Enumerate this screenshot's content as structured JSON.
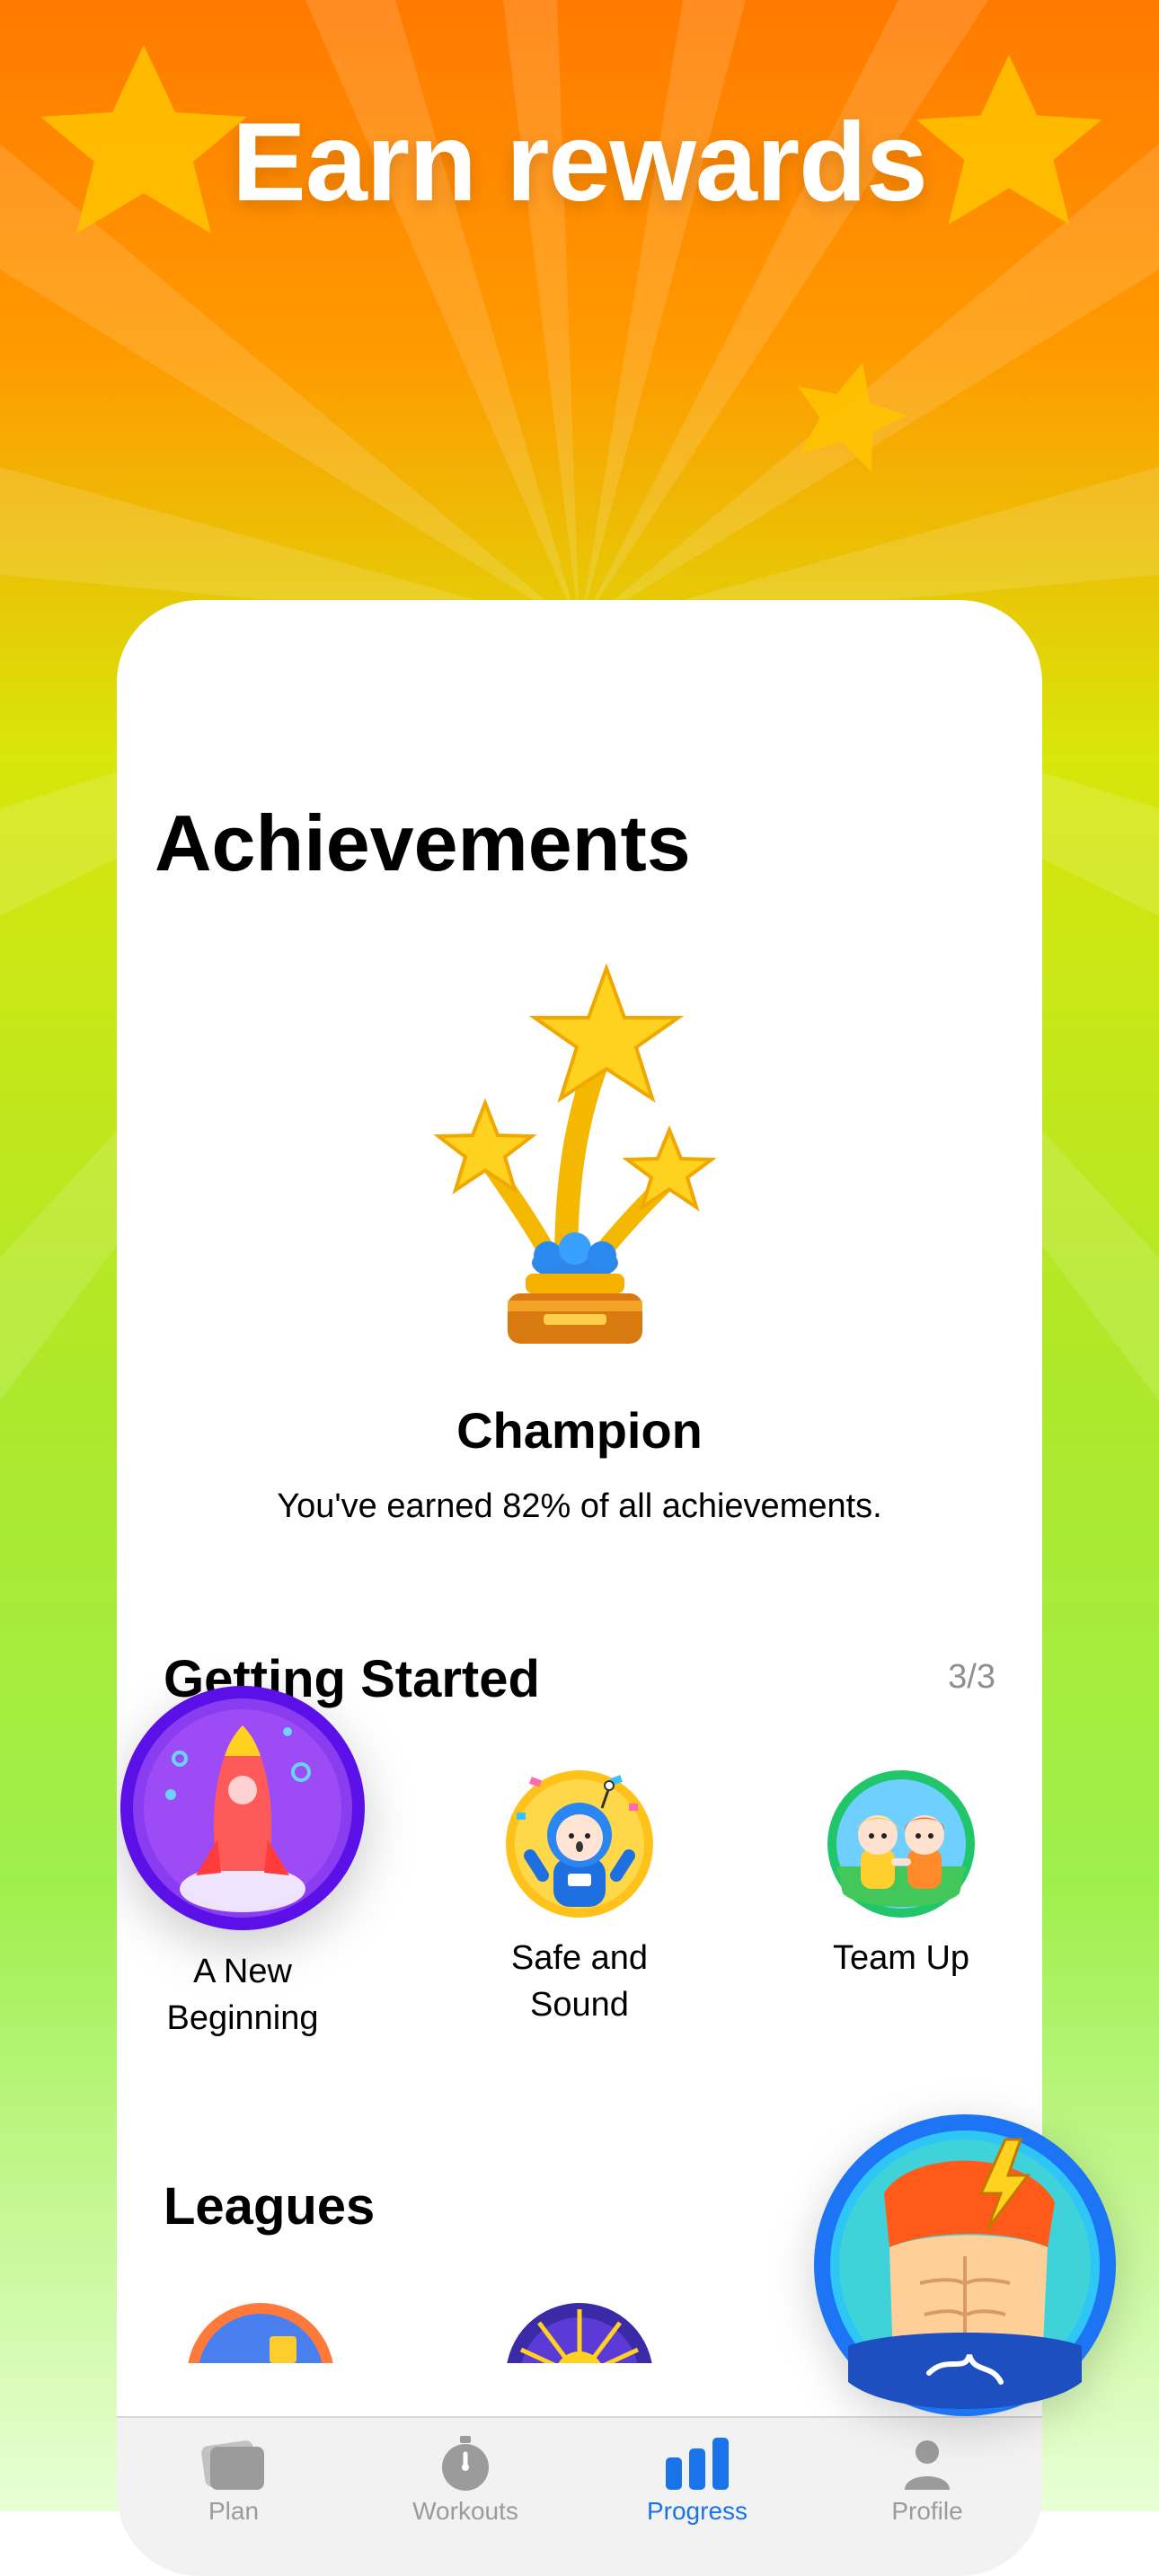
{
  "headline": "Earn rewards",
  "achievements": {
    "title": "Achievements",
    "trophy_name": "Champion",
    "earned_text": "You've earned 82% of all achievements."
  },
  "getting_started": {
    "title": "Getting Started",
    "count": "3/3",
    "badges": [
      {
        "label_line1": "A New",
        "label_line2": "Beginning"
      },
      {
        "label_line1": "Safe and",
        "label_line2": "Sound"
      },
      {
        "label_line1": "Team Up",
        "label_line2": ""
      }
    ]
  },
  "leagues": {
    "title": "Leagues"
  },
  "tabbar": {
    "tabs": [
      {
        "label": "Plan",
        "icon": "cards-icon",
        "active": false
      },
      {
        "label": "Workouts",
        "icon": "stopwatch-icon",
        "active": false
      },
      {
        "label": "Progress",
        "icon": "bar-chart-icon",
        "active": true
      },
      {
        "label": "Profile",
        "icon": "person-icon",
        "active": false
      }
    ]
  },
  "colors": {
    "accent": "#1a73e8",
    "inactive": "#9b9b9b",
    "orange": "#ff7a00",
    "green": "#a6eb3a"
  }
}
